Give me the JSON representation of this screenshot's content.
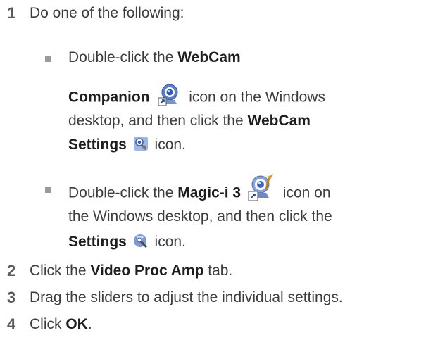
{
  "steps": [
    {
      "number": "1",
      "text": "Do one of the following:",
      "options": [
        {
          "text_1": "Double-click the ",
          "bold_1": "WebCam",
          "bold_2": "Companion",
          "text_2": " icon on the Windows",
          "text_3": "desktop, and then click the ",
          "bold_3": "WebCam",
          "bold_4": "Settings",
          "text_4": " icon.",
          "icons": [
            "webcam-companion-icon",
            "webcam-settings-icon"
          ]
        },
        {
          "text_1": "Double-click the ",
          "bold_1": "Magic-i 3",
          "text_2": " icon on",
          "text_3": "the Windows desktop, and then click the",
          "bold_2": "Settings",
          "text_4": " icon.",
          "icons": [
            "magic-i-3-icon",
            "settings-icon"
          ]
        }
      ]
    },
    {
      "number": "2",
      "text_1": "Click the ",
      "bold": "Video Proc Amp",
      "text_2": " tab."
    },
    {
      "number": "3",
      "text": "Drag the sliders to adjust the individual settings."
    },
    {
      "number": "4",
      "text_1": "Click ",
      "bold": "OK",
      "text_2": "."
    }
  ]
}
